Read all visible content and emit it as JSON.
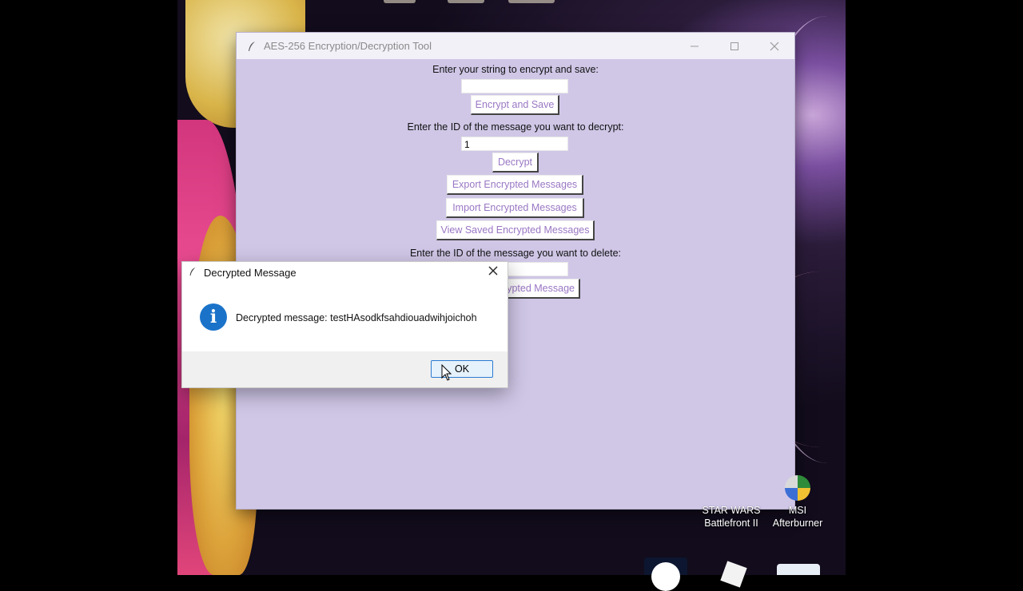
{
  "window": {
    "title": "AES-256 Encryption/Decryption Tool",
    "minimize_icon": "minimize-icon",
    "maximize_icon": "maximize-icon",
    "close_icon": "close-icon",
    "encrypt_label": "Enter your string to encrypt and save:",
    "encrypt_input_value": "",
    "encrypt_button": "Encrypt and Save",
    "decrypt_label": "Enter the ID of the message you want to decrypt:",
    "decrypt_input_value": "1",
    "decrypt_button": "Decrypt",
    "export_button": "Export Encrypted Messages",
    "import_button": "Import Encrypted Messages",
    "view_button": "View Saved Encrypted Messages",
    "delete_label": "Enter the ID of the message you want to delete:",
    "delete_button_partial": "ypted Message"
  },
  "dialog": {
    "title": "Decrypted Message",
    "icon": "info-icon",
    "message": "Decrypted message: testHAsodkfsahdiouadwihjoichoh",
    "ok_button": "OK"
  },
  "desktop_icons": [
    {
      "line1": "STAR WARS",
      "line2": "Battlefront II"
    },
    {
      "line1": "MSI",
      "line2": "Afterburner"
    }
  ]
}
